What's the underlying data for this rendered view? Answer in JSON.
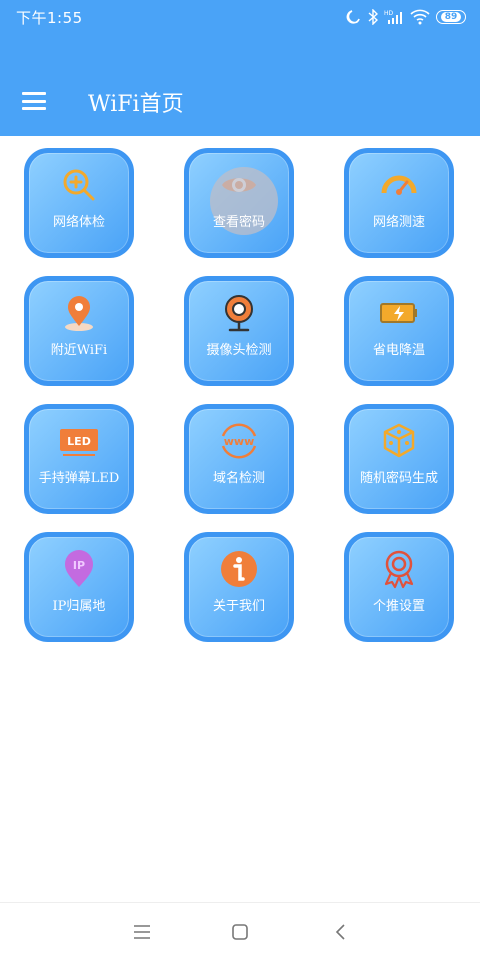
{
  "status": {
    "time": "下午1:55",
    "battery": "89"
  },
  "header": {
    "title": "WiFi首页"
  },
  "tiles": [
    {
      "label": "网络体检",
      "icon": "magnifier-plus-icon"
    },
    {
      "label": "查看密码",
      "icon": "eye-icon"
    },
    {
      "label": "网络测速",
      "icon": "speedometer-icon"
    },
    {
      "label": "附近WiFi",
      "icon": "location-pin-icon"
    },
    {
      "label": "摄像头检测",
      "icon": "webcam-icon"
    },
    {
      "label": "省电降温",
      "icon": "battery-charging-icon"
    },
    {
      "label": "手持弹幕LED",
      "icon": "led-sign-icon"
    },
    {
      "label": "域名检测",
      "icon": "www-globe-icon"
    },
    {
      "label": "随机密码生成",
      "icon": "dice-icon"
    },
    {
      "label": "IP归属地",
      "icon": "ip-pin-icon"
    },
    {
      "label": "关于我们",
      "icon": "info-icon"
    },
    {
      "label": "个推设置",
      "icon": "award-ribbon-icon"
    }
  ],
  "colors": {
    "primary": "#4aa3f7",
    "tile_border": "#3d96f2",
    "orange": "#f07e3a",
    "yellow": "#f3a92b",
    "purple": "#c36be0"
  }
}
